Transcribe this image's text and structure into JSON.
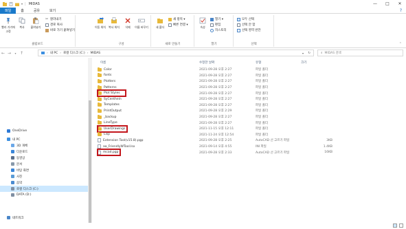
{
  "window": {
    "title": "MIDAS",
    "controls": [
      "—",
      "□",
      "✕"
    ]
  },
  "ribbon": {
    "tabs": [
      "파일",
      "홈",
      "공유",
      "보기"
    ],
    "active_tab": "파일",
    "groups": {
      "clipboard": {
        "name": "클립보드",
        "pin": "빨리 가기에 고정",
        "copy": "복사",
        "paste": "붙여넣기",
        "cut": "잘라내기",
        "copy_path": "경로 복사",
        "paste_shortcut": "바로 가기 붙여넣기"
      },
      "organize": {
        "name": "구성",
        "move_to": "이동 위치",
        "copy_to": "복사 위치",
        "delete": "삭제",
        "rename": "이름 바꾸기"
      },
      "new": {
        "name": "새로 만들기",
        "new_folder": "새 폴더",
        "new_item": "새 항목 ▾",
        "easy_access": "빠른 연결 ▾"
      },
      "open": {
        "name": "열기",
        "properties": "속성",
        "open": "열기 ▾",
        "edit": "편집",
        "history": "히스토리"
      },
      "select": {
        "name": "선택",
        "select_all": "모두 선택",
        "select_none": "선택 안 함",
        "invert": "선택 영역 반전"
      }
    }
  },
  "address": {
    "path": [
      "내 PC",
      "로컬 디스크 (C:)",
      "MIDAS"
    ],
    "search_placeholder": "MIDAS 검색"
  },
  "nav_pane": {
    "items": [
      {
        "label": "OneDrive",
        "icon": "cloud-icon",
        "color": "#2e7ad6"
      },
      {
        "label": "내 PC",
        "icon": "pc-icon",
        "color": "#3c8fe0"
      },
      {
        "label": "3D 개체",
        "icon": "cube-icon",
        "color": "#6aa7e8"
      },
      {
        "label": "다운로드",
        "icon": "download-icon",
        "color": "#3a86d9"
      },
      {
        "label": "동영상",
        "icon": "video-icon",
        "color": "#5c6f8a"
      },
      {
        "label": "문서",
        "icon": "document-icon",
        "color": "#8899aa"
      },
      {
        "label": "바탕 화면",
        "icon": "desktop-icon",
        "color": "#3a86d9"
      },
      {
        "label": "사진",
        "icon": "picture-icon",
        "color": "#5a9bd6"
      },
      {
        "label": "음악",
        "icon": "music-icon",
        "color": "#4b8bd0"
      },
      {
        "label": "로컬 디스크 (C:)",
        "icon": "drive-icon",
        "color": "#7f8fa3"
      },
      {
        "label": "DATA (D:)",
        "icon": "drive-icon",
        "color": "#7f8fa3"
      },
      {
        "label": "네트워크",
        "icon": "network-icon",
        "color": "#4a86c8"
      }
    ],
    "selected_index": 9
  },
  "file_list": {
    "columns": [
      "이름",
      "수정한 날짜",
      "유형",
      "크기"
    ],
    "rows": [
      {
        "name": "Color",
        "date": "2021-09-28 오후 2:27",
        "type": "파일 폴더",
        "size": "",
        "kind": "folder"
      },
      {
        "name": "fonts",
        "date": "2021-09-28 오후 2:27",
        "type": "파일 폴더",
        "size": "",
        "kind": "folder"
      },
      {
        "name": "Plotters",
        "date": "2021-09-28 오후 2:27",
        "type": "파일 폴더",
        "size": "",
        "kind": "folder"
      },
      {
        "name": "Patterns",
        "date": "2021-09-28 오후 2:27",
        "type": "파일 폴더",
        "size": "",
        "kind": "folder"
      },
      {
        "name": "Plot Styles",
        "date": "2021-09-28 오후 2:27",
        "type": "파일 폴더",
        "size": "",
        "kind": "folder"
      },
      {
        "name": "SyCenthein",
        "date": "2021-09-28 오후 2:27",
        "type": "파일 폴더",
        "size": "",
        "kind": "folder"
      },
      {
        "name": "Templates",
        "date": "2021-09-28 오후 2:27",
        "type": "파일 폴더",
        "size": "",
        "kind": "folder"
      },
      {
        "name": "PrintOutput",
        "date": "2021-09-28 오후 2:29",
        "type": "파일 폴더",
        "size": "",
        "kind": "folder"
      },
      {
        "name": "_backup",
        "date": "2021-09-28 오후 2:27",
        "type": "파일 폴더",
        "size": "",
        "kind": "folder"
      },
      {
        "name": "LineType",
        "date": "2021-09-28 오후 2:27",
        "type": "파일 폴더",
        "size": "",
        "kind": "folder"
      },
      {
        "name": "UserDrawings",
        "date": "2021-11-15 오후 12:11",
        "type": "파일 폴더",
        "size": "",
        "kind": "folder"
      },
      {
        "name": "Lisp",
        "date": "2021-11-24 오후 12:54",
        "type": "파일 폴더",
        "size": "",
        "kind": "folder"
      },
      {
        "name": "Extension Tool(v15.8).pgp",
        "date": "2021-09-28 오후 2:25",
        "type": "AutoCAD 선 고르기 파일",
        "size": "3KB",
        "kind": "file"
      },
      {
        "name": "aa_FriendlyWTool.lsx",
        "date": "2021-09-14 오후 4:55",
        "type": "INI 파일",
        "size": "1.4KB",
        "kind": "file"
      },
      {
        "name": "mcad.pgp",
        "date": "2021-09-28 오후 2:33",
        "type": "AutoCAD 선 고르기 파일",
        "size": "16KB",
        "kind": "file"
      }
    ],
    "highlighted": [
      "Plot Styles",
      "UserDrawings",
      "mcad.pgp"
    ],
    "highlight_color": "#c3161c"
  },
  "status_bar": {
    "text": ""
  }
}
